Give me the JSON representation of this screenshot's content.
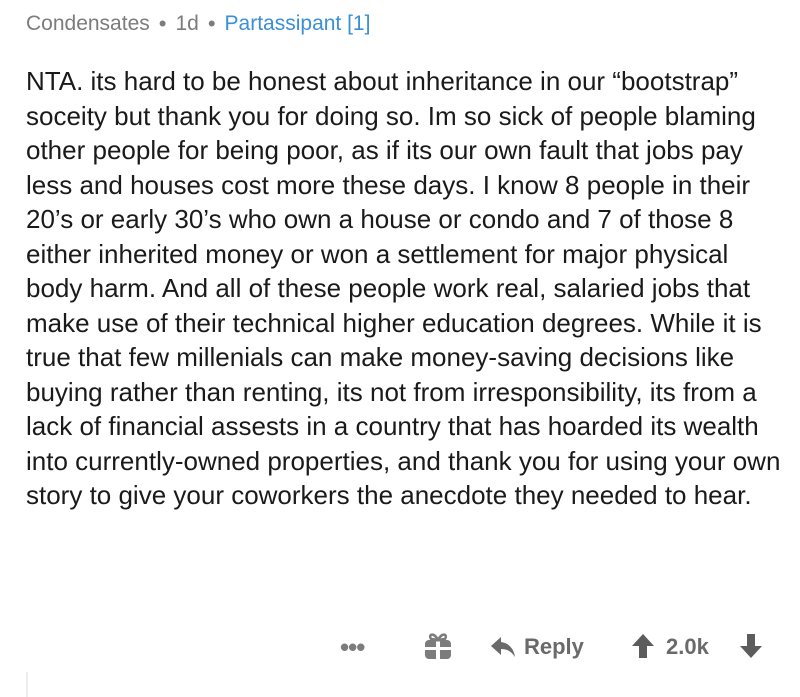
{
  "comment": {
    "author": "Condensates",
    "separator": "•",
    "age": "1d",
    "flair": "Partassipant [1]",
    "body": "NTA. its hard to be honest about inheritance in our “bootstrap” soceity but thank you for doing so. Im so sick of people blaming other people for being poor, as if its our own fault that jobs pay less and houses cost more these days. I know 8 people in their 20’s or early 30’s who own a house or condo and 7 of those 8 either inherited money or won a settlement for major physical body harm. And all of these people work real, salaried jobs that make use of their technical higher education degrees. While it is true that few millenials can make money-saving decisions like buying rather than renting, its not from irresponsibility, its from a lack of financial assests in a country that has hoarded its wealth into currently-owned properties, and thank you for using your own story to give your coworkers the anecdote they needed to hear."
  },
  "actions": {
    "more_label": "•••",
    "award_icon": "gift-icon",
    "reply_label": "Reply",
    "score": "2.0k",
    "upvote_icon": "upvote-arrow-icon",
    "downvote_icon": "downvote-arrow-icon"
  }
}
